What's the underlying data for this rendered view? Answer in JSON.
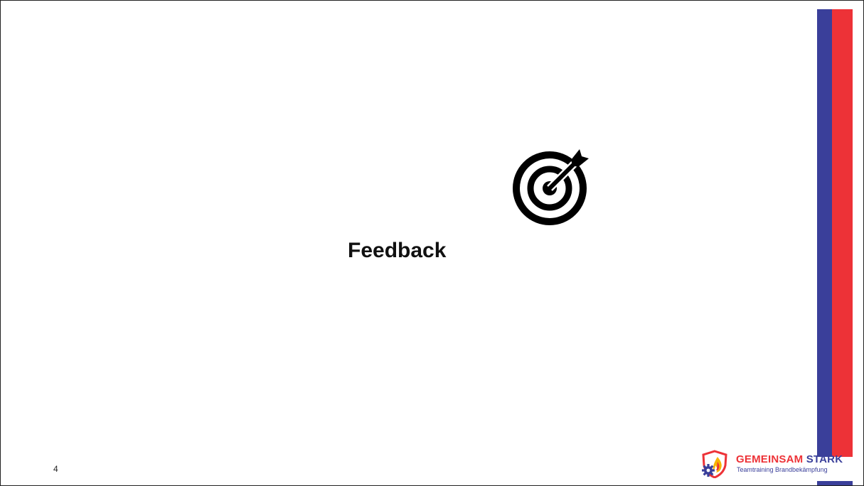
{
  "slide": {
    "title": "Feedback",
    "page_number": "4",
    "icon": "target-arrow-icon"
  },
  "logo": {
    "name_part1": "GEMEINSAM",
    "name_part2": "STARK",
    "tagline": "Teamtraining Brandbekämpfung",
    "icon": "shield-gear-flame-icon"
  },
  "colors": {
    "stripe_blue": "#3a3f9a",
    "stripe_red": "#ed3237",
    "text": "#111111"
  }
}
